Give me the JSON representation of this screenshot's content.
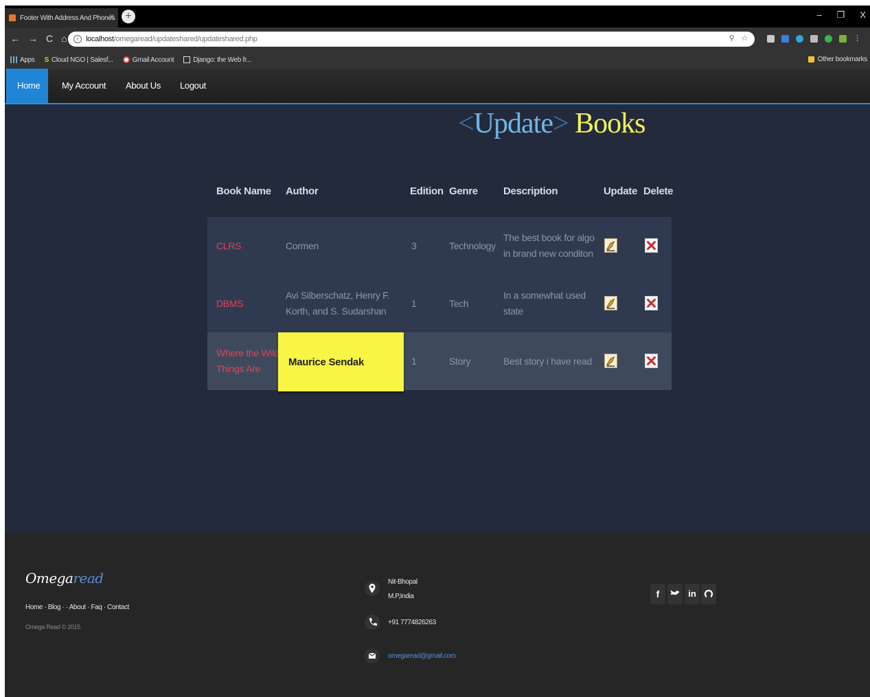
{
  "browser": {
    "tab_title": "Footer With Address And Phones",
    "tab_close": "X",
    "new_tab": "+",
    "win_controls": [
      "–",
      "❐",
      "X"
    ],
    "url_host": "localhost",
    "url_path": "/omegaread/updateshared/updateshared.php",
    "bookmarks": [
      "Apps",
      "Cloud NGO | Salesf...",
      "Gmail Account",
      "Django: the Web fr..."
    ],
    "other_bookmarks": "Other bookmarks"
  },
  "nav": {
    "items": [
      "Home",
      "My Account",
      "About Us",
      "Logout"
    ],
    "active": "Home"
  },
  "heading": {
    "open": "<",
    "word1": "Update",
    "close": ">",
    "word2": "Books"
  },
  "table": {
    "headers": [
      "Book Name",
      "Author",
      "Edition",
      "Genre",
      "Description",
      "Update",
      "Delete"
    ],
    "rows": [
      {
        "book_name": [
          "CLRS"
        ],
        "author": [
          "Cormen"
        ],
        "edition": "3",
        "genre": "Technology",
        "description": [
          "The best book for algo",
          "in brand new conditon"
        ]
      },
      {
        "book_name": [
          "DBMS"
        ],
        "author": [
          "Avi Silberschatz, Henry F.",
          "Korth, and S. Sudarshan"
        ],
        "edition": "1",
        "genre": "Tech",
        "description": [
          "In a somewhat used",
          "state"
        ]
      },
      {
        "book_name": [
          "Where the Wild",
          "Things Are"
        ],
        "author": [
          "Maurice Sendak"
        ],
        "edition": "1",
        "genre": "Story",
        "description": [
          "Best story i have read"
        ]
      }
    ],
    "highlighted_cell": "Maurice Sendak"
  },
  "footer": {
    "logo_part1": "Omega",
    "logo_part2": "read",
    "links": "Home · Blog · · About · Faq · Contact",
    "copyright": "Omega Read © 2015",
    "address_line1": "Nit-Bhopal",
    "address_line2": "M.P,India",
    "phone": "+91 7774826263",
    "email": "omegaread@gmail.com",
    "social": [
      "f",
      "t",
      "in",
      "gh"
    ]
  },
  "colors": {
    "page_bg": "#232a3b",
    "nav_active": "#1f86d6",
    "heading_word1": "#6fb6ea",
    "heading_word2": "#f2f25a",
    "book_name": "#e0435a",
    "highlight": "#f9f545",
    "footer_bg": "#262626"
  }
}
